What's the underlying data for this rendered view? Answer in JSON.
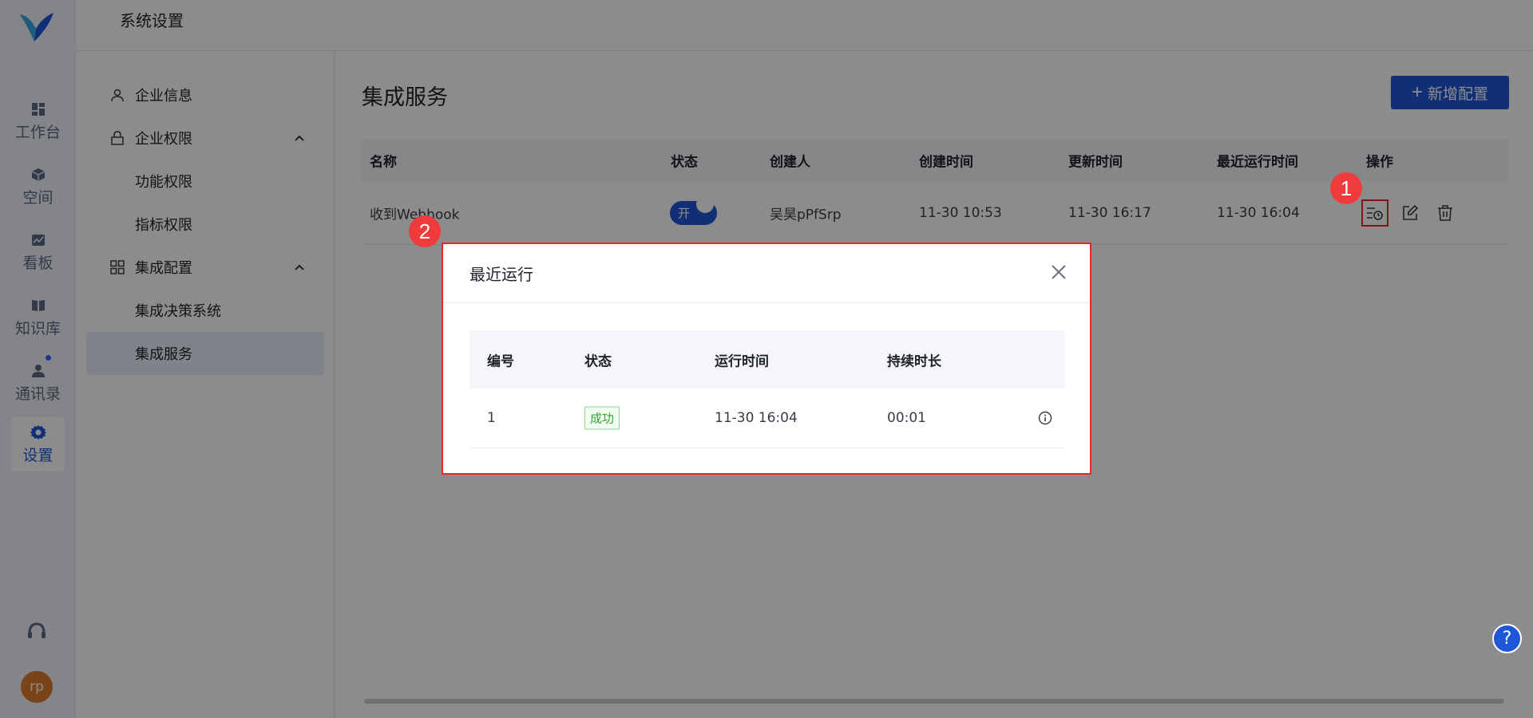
{
  "header": {
    "title": "系统设置"
  },
  "rail": {
    "items": [
      {
        "label": "工作台",
        "icon": "dashboard-icon"
      },
      {
        "label": "空间",
        "icon": "cube-icon"
      },
      {
        "label": "看板",
        "icon": "chart-board-icon"
      },
      {
        "label": "知识库",
        "icon": "book-icon"
      },
      {
        "label": "通讯录",
        "icon": "contacts-icon"
      },
      {
        "label": "设置",
        "icon": "gear-icon"
      }
    ],
    "active": "设置",
    "avatar_initials": "rp"
  },
  "submenu": {
    "items": [
      {
        "label": "企业信息",
        "icon": "user-icon"
      },
      {
        "label": "企业权限",
        "icon": "lock-icon",
        "expanded": true
      },
      {
        "label": "功能权限"
      },
      {
        "label": "指标权限"
      },
      {
        "label": "集成配置",
        "icon": "grid-icon",
        "expanded": true
      },
      {
        "label": "集成决策系统"
      },
      {
        "label": "集成服务",
        "active": true
      }
    ]
  },
  "main": {
    "title": "集成服务",
    "add_button": "新增配置",
    "table": {
      "columns": [
        "名称",
        "状态",
        "创建人",
        "创建时间",
        "更新时间",
        "最近运行时间",
        "操作"
      ],
      "rows": [
        {
          "name": "收到Webhook",
          "status_toggle": "开",
          "creator": "吴昊pPfSrp",
          "created": "11-30 10:53",
          "updated": "11-30 16:17",
          "last_run": "11-30 16:04"
        }
      ]
    }
  },
  "annotations": {
    "step1": "1",
    "step2": "2"
  },
  "modal": {
    "title": "最近运行",
    "columns": [
      "编号",
      "状态",
      "运行时间",
      "持续时长"
    ],
    "rows": [
      {
        "id": "1",
        "status": "成功",
        "run_time": "11-30 16:04",
        "duration": "00:01"
      }
    ]
  },
  "help_fab": "?",
  "colors": {
    "primary": "#1f57d9",
    "highlight": "#e7262d",
    "success": "#35a535",
    "badge": "#ef3b3b"
  }
}
